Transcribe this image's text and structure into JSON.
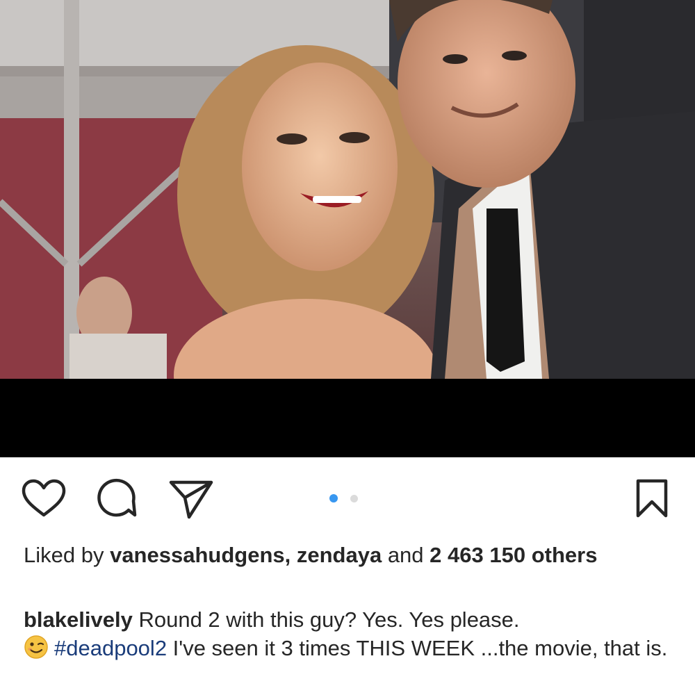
{
  "post": {
    "image": {
      "description_icon": "photo-selfie-icon",
      "colors": {
        "background": "#6e5a52",
        "letterbox": "#000000"
      }
    },
    "actions": {
      "like_icon": "heart-icon",
      "comment_icon": "comment-bubble-icon",
      "share_icon": "paper-plane-icon",
      "save_icon": "bookmark-icon"
    },
    "carousel": {
      "active_color": "#3897f0",
      "inactive_color": "#dbdbdb"
    },
    "likes": {
      "prefix": "Liked by ",
      "user1": "vanessahudgens",
      "separator": ", ",
      "user2": "zendaya",
      "and": " and ",
      "count": "2 463 150",
      "suffix": " others"
    },
    "caption": {
      "username": "blakelively",
      "text1": " Round 2 with this guy? Yes. Yes please.",
      "emoji_icon": "winking-face-icon",
      "hashtag": "#deadpool2",
      "text2": " I've seen it 3 times THIS WEEK ...the movie, that is."
    }
  }
}
